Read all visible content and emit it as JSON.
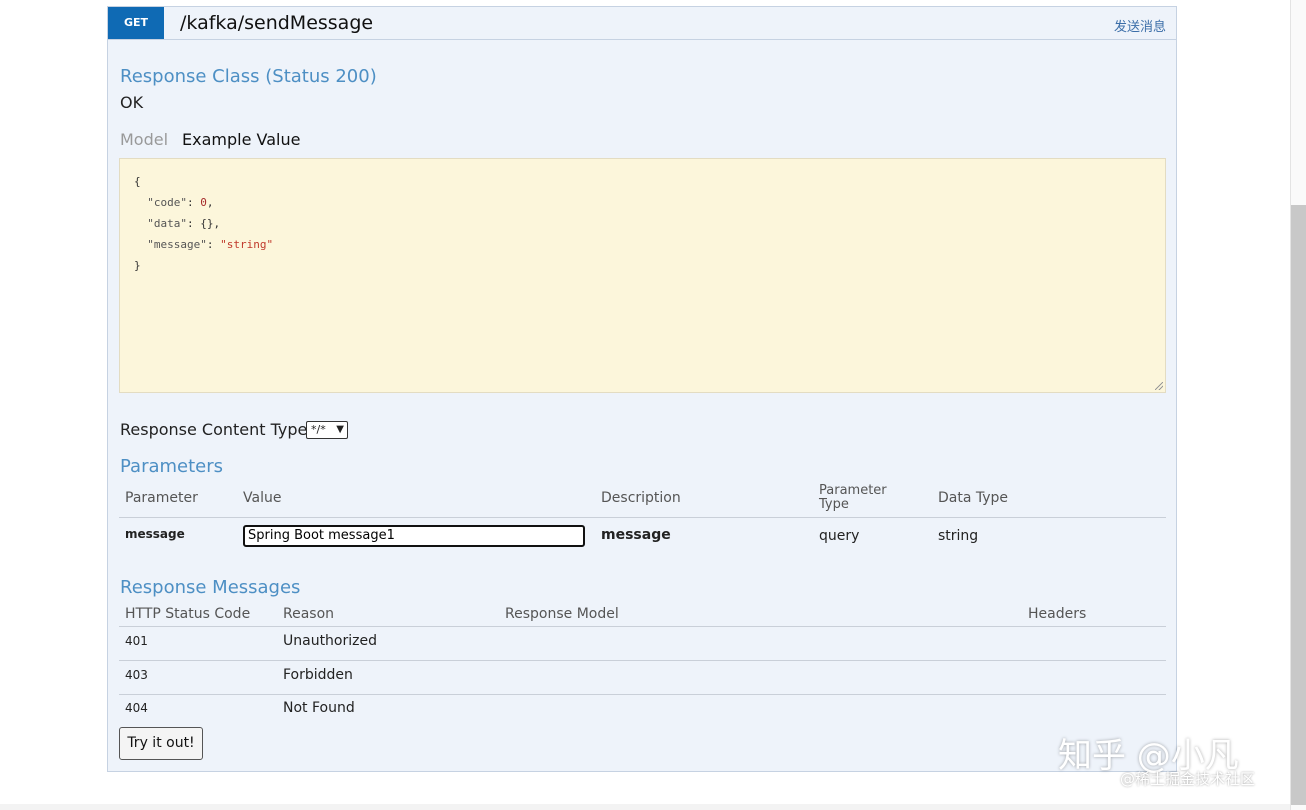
{
  "operation": {
    "method": "GET",
    "path": "/kafka/sendMessage",
    "summary": "发送消息"
  },
  "response_class": {
    "title": "Response Class (Status 200)",
    "value": "OK",
    "tabs": {
      "model": "Model",
      "example": "Example Value"
    },
    "sample_json": [
      "{",
      "  \"code\": 0,",
      "  \"data\": {},",
      "  \"message\": \"string\"",
      "}"
    ]
  },
  "content_type": {
    "label": "Response Content Type",
    "selected": "*/*"
  },
  "parameters": {
    "title": "Parameters",
    "headers": [
      "Parameter",
      "Value",
      "Description",
      "Parameter Type",
      "Data Type"
    ],
    "rows": [
      {
        "name": "message",
        "value": "Spring Boot message1",
        "description": "message",
        "param_type": "query",
        "data_type": "string"
      }
    ]
  },
  "response_messages": {
    "title": "Response Messages",
    "headers": [
      "HTTP Status Code",
      "Reason",
      "Response Model",
      "Headers"
    ],
    "rows": [
      {
        "code": "401",
        "reason": "Unauthorized"
      },
      {
        "code": "403",
        "reason": "Forbidden"
      },
      {
        "code": "404",
        "reason": "Not Found"
      }
    ]
  },
  "try_button": "Try it out!",
  "watermark": {
    "main": "知乎 @小凡",
    "sub": "@稀土掘金技术社区"
  },
  "colors": {
    "method_badge": "#0f6ab4",
    "section_title": "#4d8fc4",
    "sample_bg": "#fcf6db",
    "card_bg": "#eef3fa"
  }
}
